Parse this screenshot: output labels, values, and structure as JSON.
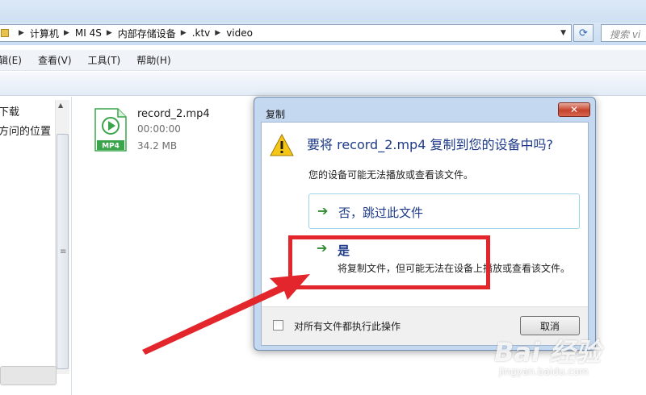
{
  "address_bar": {
    "breadcrumbs": [
      "计算机",
      "MI 4S",
      "内部存储设备",
      ".ktv",
      "video"
    ],
    "search_placeholder": "搜索 vi"
  },
  "menu": [
    "编辑(E)",
    "查看(V)",
    "工具(T)",
    "帮助(H)"
  ],
  "menu_visible": [
    "辑(E)",
    "查看(V)",
    "工具(T)",
    "帮助(H)"
  ],
  "nav_pane": {
    "items": [
      "下载",
      "访问的位置"
    ],
    "items_visible": [
      "下载",
      "方问的位置"
    ]
  },
  "file": {
    "name": "record_2.mp4",
    "duration": "00:00:00",
    "size": "34.2 MB",
    "badge": "MP4"
  },
  "dialog": {
    "title": "复制",
    "close_label": "✕",
    "question": "要将 record_2.mp4 复制到您的设备中吗?",
    "subtext": "您的设备可能无法播放或查看该文件。",
    "option_skip": {
      "label": "否，跳过此文件"
    },
    "option_yes": {
      "label": "是",
      "description": "将复制文件，但可能无法在设备上播放或查看该文件。"
    },
    "apply_all_label": "对所有文件都执行此操作",
    "apply_all_checked": false,
    "cancel_label": "取消"
  },
  "watermark": {
    "logo": "Bai 经验",
    "url": "jingyan.baidu.com"
  },
  "colors": {
    "annotation": "#e3262c",
    "dialog_frame": "#c4d8ef",
    "link_text": "#1e3a8a",
    "arrow_green": "#2e8b2e"
  }
}
